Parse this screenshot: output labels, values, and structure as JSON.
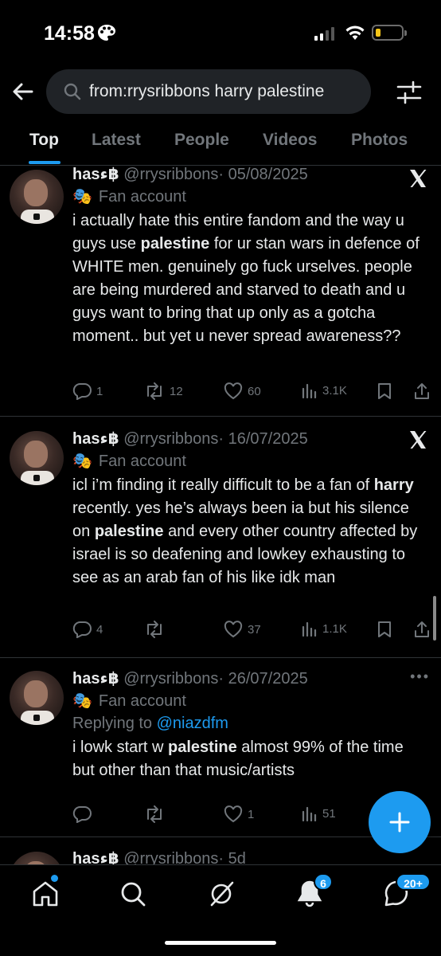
{
  "status_bar": {
    "time": "14:58",
    "battery_level": 0.2,
    "battery_color": "#f5c518"
  },
  "header": {
    "search_query": "from:rrysribbons harry palestine"
  },
  "tabs": [
    {
      "label": "Top",
      "active": true
    },
    {
      "label": "Latest",
      "active": false
    },
    {
      "label": "People",
      "active": false
    },
    {
      "label": "Videos",
      "active": false
    },
    {
      "label": "Photos",
      "active": false
    }
  ],
  "tweets": [
    {
      "display_name": "hasء฿",
      "meta": "@rrysribbons· 05/08/2025",
      "label": "Fan account",
      "body_parts": [
        "i actually hate this entire fandom and the way u guys use ",
        "palestine",
        " for ur stan wars in defence of WHITE men. genuinely go fuck urselves. people are being murdered and starved to death and u guys want to bring that up only as a gotcha moment.. but yet u never spread awareness??"
      ],
      "replies": "1",
      "reposts": "12",
      "likes": "60",
      "views": "3.1K"
    },
    {
      "display_name": "hasء฿",
      "meta": "@rrysribbons· 16/07/2025",
      "label": "Fan account",
      "body_parts": [
        "icl i’m finding it really difficult to be a fan of ",
        "harry",
        " recently. yes he’s always been ia but his silence on ",
        "palestine",
        " and every other country affected by israel is so deafening and lowkey exhausting to see as an arab fan of his like idk man"
      ],
      "replies": "4",
      "reposts": "",
      "likes": "37",
      "views": "1.1K"
    },
    {
      "display_name": "hasء฿",
      "meta": "@rrysribbons· 26/07/2025",
      "label": "Fan account",
      "replying_prefix": "Replying to ",
      "replying_handle": "@niazdfm",
      "body_parts": [
        "i lowk start w ",
        "palestine",
        " almost 99% of the time but other than that music/artists"
      ],
      "replies": "",
      "reposts": "",
      "likes": "1",
      "views": "51"
    },
    {
      "display_name": "hasء฿",
      "meta": "@rrysribbons· 5d"
    }
  ],
  "bottom_nav": {
    "notifications_badge": "6",
    "messages_badge": "20+"
  },
  "colors": {
    "accent": "#1d9bf0",
    "background": "#000000",
    "muted_text": "#71767b"
  }
}
